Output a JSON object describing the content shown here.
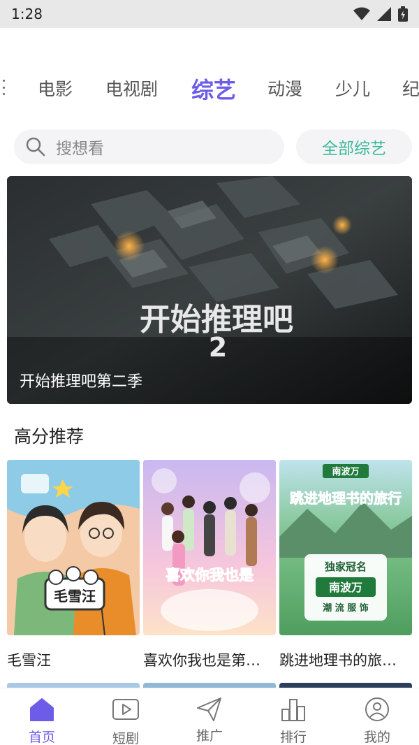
{
  "status_bar": {
    "time": "1:28"
  },
  "category_tabs": [
    {
      "label": "电影",
      "active": false
    },
    {
      "label": "电视剧",
      "active": false
    },
    {
      "label": "综艺",
      "active": true
    },
    {
      "label": "动漫",
      "active": false
    },
    {
      "label": "少儿",
      "active": false
    },
    {
      "label": "纪",
      "active": false
    }
  ],
  "search": {
    "placeholder": "搜想看"
  },
  "all_button": {
    "label": "全部综艺"
  },
  "banner": {
    "logo_text": "开始推理吧",
    "logo_number": "2",
    "caption": "开始推理吧第二季"
  },
  "section": {
    "title": "高分推荐"
  },
  "cards": [
    {
      "title": "毛雪汪",
      "poster_text": "毛雪汪"
    },
    {
      "title": "喜欢你我也是第…",
      "poster_text": "喜欢你我也是"
    },
    {
      "title": "跳进地理书的旅…",
      "poster_text": "跳进地理书的旅行",
      "sponsor_label": "独家冠名",
      "sponsor": "南波万",
      "sponsor_tagline": "潮 流 服 饰"
    }
  ],
  "bottom_nav": [
    {
      "label": "首页",
      "icon": "home-icon",
      "active": true
    },
    {
      "label": "短剧",
      "icon": "play-icon",
      "active": false
    },
    {
      "label": "推广",
      "icon": "send-icon",
      "active": false
    },
    {
      "label": "排行",
      "icon": "chart-icon",
      "active": false
    },
    {
      "label": "我的",
      "icon": "user-icon",
      "active": false
    }
  ],
  "colors": {
    "accent": "#6d5ce8",
    "teal": "#3ab89a"
  }
}
